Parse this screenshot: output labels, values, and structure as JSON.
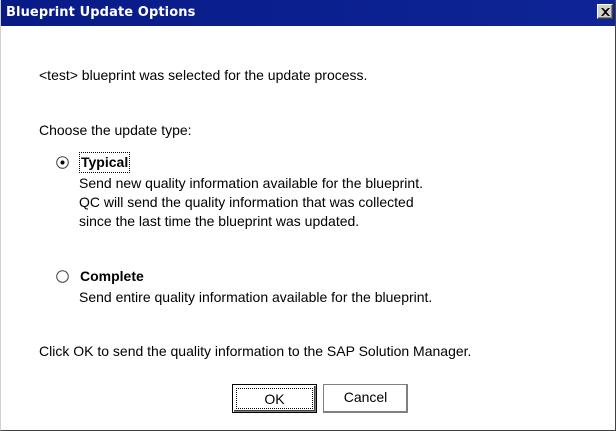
{
  "window": {
    "title": "Blueprint Update Options"
  },
  "message": {
    "selected_text": "<test> blueprint was selected for the update process.",
    "choose_text": "Choose the update type:",
    "footer_text": "Click OK to send the quality information to the SAP Solution Manager."
  },
  "options": [
    {
      "label": "Typical",
      "selected": true,
      "description_lines": [
        "Send new quality information available for the blueprint.",
        "QC will send the quality information that was collected",
        "since the last time the blueprint was updated."
      ]
    },
    {
      "label": "Complete",
      "selected": false,
      "description_lines": [
        "Send entire quality information available for the blueprint."
      ]
    }
  ],
  "buttons": {
    "ok_label": "OK",
    "cancel_label": "Cancel"
  },
  "colors": {
    "titlebar": "#0c1f8f",
    "titlebar_text": "#ffffff",
    "background": "#ffffff"
  },
  "icons": {
    "close": "close-icon",
    "radio_selected": "radio-selected-icon",
    "radio_unselected": "radio-unselected-icon"
  }
}
